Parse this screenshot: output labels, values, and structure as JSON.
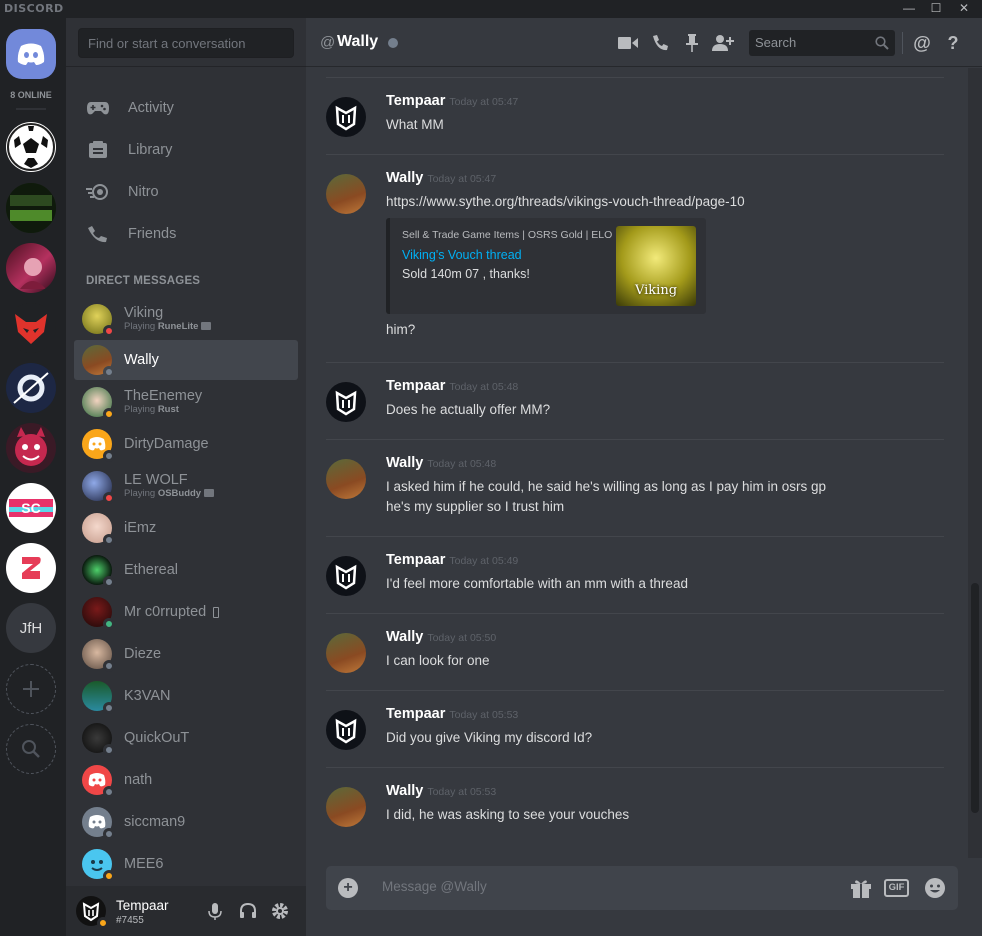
{
  "app": {
    "brand": "DISCORD"
  },
  "window_controls": {
    "minimize": "—",
    "maximize": "☐",
    "close": "✕"
  },
  "guilds": {
    "online_count": "8 ONLINE",
    "text_guild": "JfH"
  },
  "sidebar": {
    "search_placeholder": "Find or start a conversation",
    "nav": [
      {
        "label": "Activity",
        "icon": "gamepad-icon"
      },
      {
        "label": "Library",
        "icon": "library-icon"
      },
      {
        "label": "Nitro",
        "icon": "nitro-icon"
      },
      {
        "label": "Friends",
        "icon": "friends-icon"
      }
    ],
    "dm_header": "DIRECT MESSAGES",
    "dms": [
      {
        "name": "Viking",
        "status": "dnd",
        "activity_prefix": "Playing ",
        "activity_game": "RuneLite"
      },
      {
        "name": "Wally",
        "status": "offline",
        "active": true
      },
      {
        "name": "TheEnemey",
        "status": "idle",
        "activity_prefix": "Playing ",
        "activity_game": "Rust"
      },
      {
        "name": "DirtyDamage",
        "status": "offline"
      },
      {
        "name": "LE WOLF",
        "status": "dnd",
        "activity_prefix": "Playing ",
        "activity_game": "OSBuddy"
      },
      {
        "name": "iEmz",
        "status": "offline"
      },
      {
        "name": "Ethereal",
        "status": "offline"
      },
      {
        "name": "Mr c0rrupted",
        "status": "online",
        "mobile": true
      },
      {
        "name": "Dieze",
        "status": "offline"
      },
      {
        "name": "K3VAN",
        "status": "offline"
      },
      {
        "name": "QuickOuT",
        "status": "offline"
      },
      {
        "name": "nath",
        "status": "offline"
      },
      {
        "name": "siccman9",
        "status": "offline"
      },
      {
        "name": "MEE6",
        "status": "idle"
      }
    ]
  },
  "user": {
    "name": "Tempaar",
    "tag": "#7455",
    "status": "idle"
  },
  "header": {
    "at": "@",
    "title": "Wally",
    "search_placeholder": "Search"
  },
  "messages": [
    {
      "author": "Tempaar",
      "time": "Today at 05:47",
      "lines": [
        "What MM"
      ]
    },
    {
      "author": "Wally",
      "time": "Today at 05:47",
      "link": "https://www.sythe.org/threads/vikings-vouch-thread/page-10",
      "embed": {
        "provider": "Sell & Trade Game Items | OSRS Gold | ELO",
        "title": "Viking's Vouch thread",
        "description": "Sold 140m 07 , thanks!",
        "thumb_text": "Viking"
      },
      "after": "him?"
    },
    {
      "author": "Tempaar",
      "time": "Today at 05:48",
      "lines": [
        "Does he actually offer MM?"
      ]
    },
    {
      "author": "Wally",
      "time": "Today at 05:48",
      "lines": [
        "I asked him if he could, he said he's willing as long as I pay him in osrs gp",
        "he's my supplier so I trust him"
      ]
    },
    {
      "author": "Tempaar",
      "time": "Today at 05:49",
      "lines": [
        "I'd feel more comfortable with an mm with a thread"
      ]
    },
    {
      "author": "Wally",
      "time": "Today at 05:50",
      "lines": [
        "I can look for one"
      ]
    },
    {
      "author": "Tempaar",
      "time": "Today at 05:53",
      "lines": [
        "Did you give Viking my discord Id?"
      ]
    },
    {
      "author": "Wally",
      "time": "Today at 05:53",
      "lines": [
        "I did, he was asking to see your vouches"
      ]
    }
  ],
  "composer": {
    "placeholder": "Message @Wally",
    "gif": "GIF"
  },
  "colors": {
    "blurple": "#7289da",
    "online": "#43b581",
    "idle": "#faa61a",
    "dnd": "#f04747",
    "offline": "#747f8d",
    "link": "#00b0f4"
  }
}
